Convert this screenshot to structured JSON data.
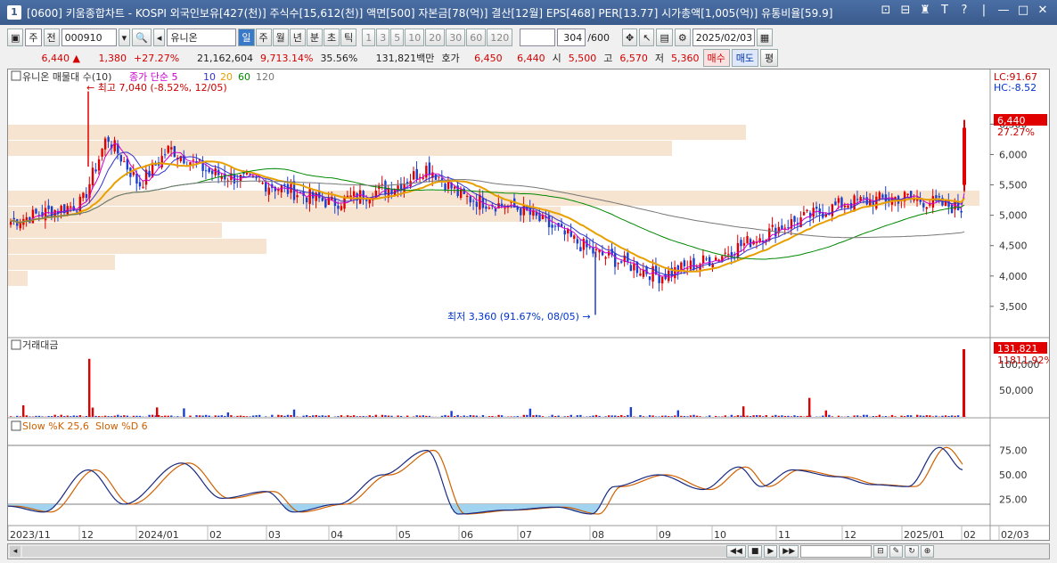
{
  "titlebar": {
    "icon": "1",
    "title": "[0600] 키움종합차트 - KOSPI 외국인보유[427(천)] 주식수[15,612(천)] 액면[500] 자본금[78(억)] 결산[12월] EPS[468] PER[13.77] 시가총액[1,005(억)] 유통비율[59.9]",
    "buttons": [
      "⊡",
      "⊟",
      "♜",
      "T",
      "?",
      "|",
      "—",
      "□",
      "✕"
    ]
  },
  "toolbar": {
    "period_select": "주",
    "prev_label": "전",
    "code": "000910",
    "name": "유니온",
    "tabs": [
      "일",
      "주",
      "월",
      "년",
      "분",
      "초",
      "틱"
    ],
    "active_tab": "일",
    "intervals": [
      "1",
      "3",
      "5",
      "10",
      "20",
      "30",
      "60",
      "120"
    ],
    "count": "304",
    "count_total": "/600",
    "date": "2025/02/03"
  },
  "quote": {
    "price": "6,440",
    "change": "1,380",
    "change_rate": "+27.27%",
    "volume": "21,162,604",
    "volume_rate": "9,713.14%",
    "turnover": "35.56%",
    "amount": "131,821백만",
    "hoga_label": "호가",
    "hoga1": "6,450",
    "hoga2": "6,440",
    "open_label": "시",
    "open": "5,500",
    "high_label": "고",
    "high": "6,570",
    "low_label": "저",
    "low": "5,360",
    "buy": "매수",
    "sell": "매도",
    "eval": "평"
  },
  "price_panel": {
    "legend_title": "유니온 매물대 수(10)",
    "ma_label": "종가 단순 5",
    "ma_periods": [
      "10",
      "20",
      "60",
      "120"
    ],
    "ma_colors": [
      "#cc00cc",
      "#3333cc",
      "#e8a000",
      "#008800",
      "#777777"
    ],
    "max_annotation": "최고 7,040 (-8.52%, 12/05)",
    "min_annotation": "최저 3,360 (91.67%, 08/05)",
    "lc": "LC:91.67",
    "hc": "HC:-8.52",
    "last_price": "6,440",
    "last_rate": "27.27%",
    "y_ticks": [
      "6,500",
      "6,000",
      "5,500",
      "5,000",
      "4,500",
      "4,000",
      "3,500"
    ]
  },
  "volume_panel": {
    "title": "거래대금",
    "last_value": "131,821",
    "last_rate": "11811.92%",
    "y_ticks": [
      "100,000",
      "50,000"
    ]
  },
  "stoch_panel": {
    "title_k": "Slow %K 25,6",
    "title_d": "Slow %D 6",
    "y_ticks": [
      "75.00",
      "50.00",
      "25.00"
    ]
  },
  "x_axis": [
    "2023/11",
    "12",
    "2024/01",
    "02",
    "03",
    "04",
    "05",
    "06",
    "07",
    "08",
    "09",
    "10",
    "11",
    "12",
    "2025/01",
    "02",
    "02/03"
  ],
  "colors": {
    "up": "#e00000",
    "down": "#1a3fd0",
    "volume_profile": "#f6e4d0"
  },
  "chart_data": {
    "type": "candlestick",
    "price_anchors": [
      [
        "2023/11",
        4900
      ],
      [
        "2023/12 start",
        5200
      ],
      [
        "2023/12 mid",
        6300
      ],
      [
        "2024/01",
        5500
      ],
      [
        "2024/01 late",
        6100
      ],
      [
        "2024/02",
        5700
      ],
      [
        "2024/03",
        5500
      ],
      [
        "2024/04",
        5200
      ],
      [
        "2024/05",
        5500
      ],
      [
        "2024/05 mid",
        5800
      ],
      [
        "2024/06",
        5300
      ],
      [
        "2024/07",
        5100
      ],
      [
        "2024/08",
        4400
      ],
      [
        "2024/09",
        4000
      ],
      [
        "2024/10",
        4300
      ],
      [
        "2024/11",
        4800
      ],
      [
        "2024/12",
        5200
      ],
      [
        "2025/01",
        5300
      ],
      [
        "2025/02",
        6440
      ]
    ],
    "max": 7040,
    "min": 3360,
    "last": 6440
  }
}
